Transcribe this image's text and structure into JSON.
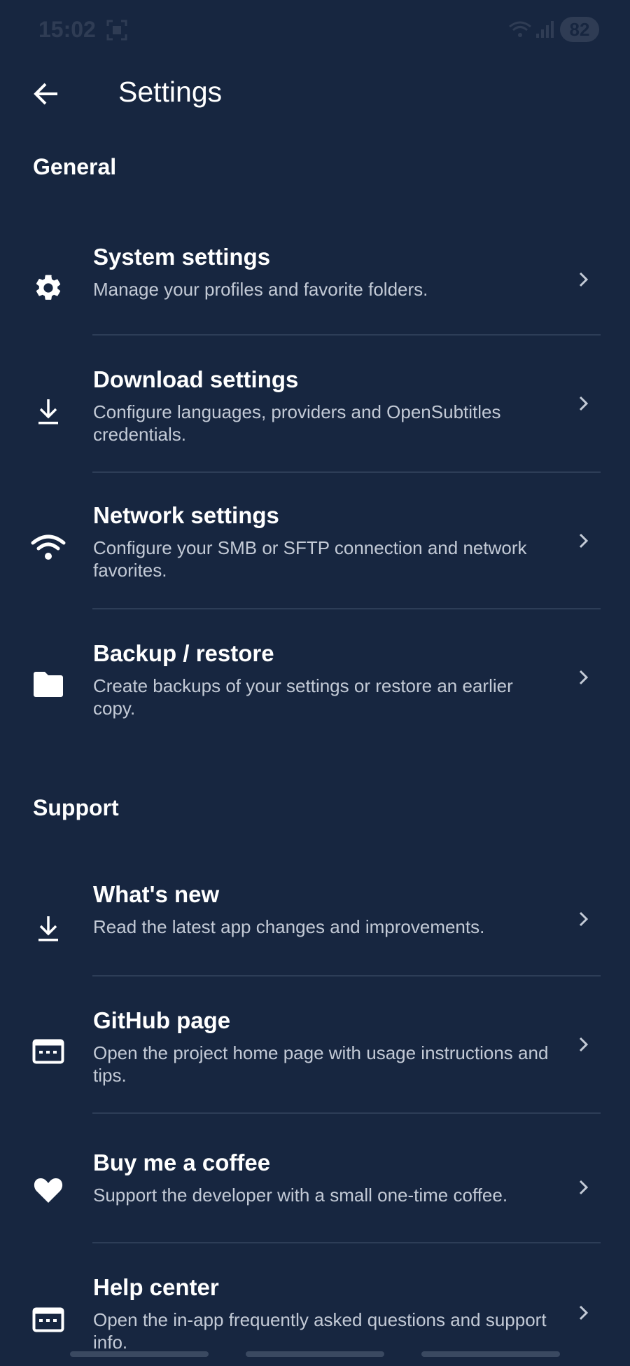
{
  "status_bar": {
    "time": "15:02",
    "battery": "82"
  },
  "app_bar": {
    "title": "Settings",
    "back_icon": "arrow-left-icon"
  },
  "sections": [
    {
      "header": "General",
      "items": [
        {
          "title": "System settings",
          "subtitle": "Manage your profiles and favorite folders.",
          "icon": "gear-icon"
        },
        {
          "title": "Download settings",
          "subtitle": "Configure languages, providers and OpenSubtitles credentials.",
          "icon": "download-icon"
        },
        {
          "title": "Network settings",
          "subtitle": "Configure your SMB or SFTP connection and network favorites.",
          "icon": "wifi-icon"
        },
        {
          "title": "Backup / restore",
          "subtitle": "Create backups of your settings or restore an earlier copy.",
          "icon": "folder-icon"
        }
      ]
    },
    {
      "header": "Support",
      "items": [
        {
          "title": "What's new",
          "subtitle": "Read the latest app changes and improvements.",
          "icon": "download-icon"
        },
        {
          "title": "GitHub page",
          "subtitle": "Open the project home page with usage instructions and tips.",
          "icon": "browser-window-icon"
        },
        {
          "title": "Buy me a coffee",
          "subtitle": "Support the developer with a small one-time coffee.",
          "icon": "heart-icon"
        },
        {
          "title": "Help center",
          "subtitle": "Open the in-app frequently asked questions and support info.",
          "icon": "browser-window-icon"
        }
      ]
    }
  ],
  "colors": {
    "background": "#172640",
    "text_primary": "#ffffff",
    "text_secondary": "#c3cad6",
    "divider": "#2d3d57"
  }
}
